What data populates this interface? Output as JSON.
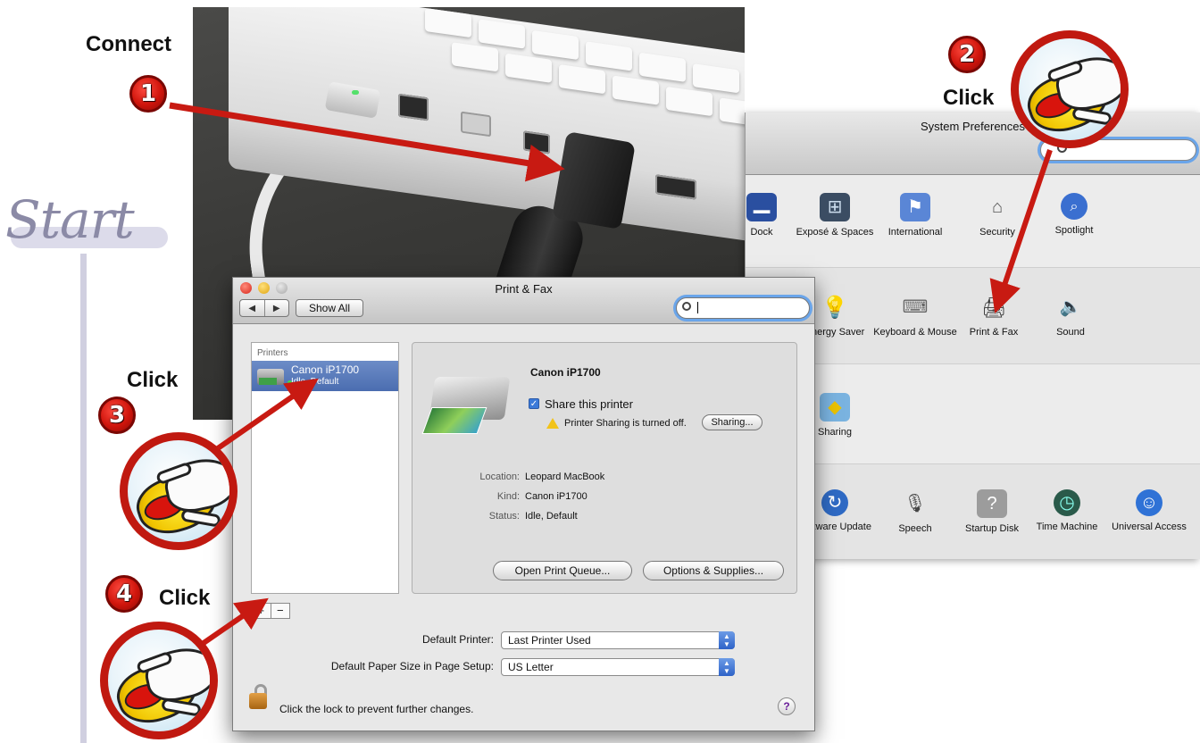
{
  "steps": {
    "start": "Start",
    "step1": {
      "number": "1",
      "label": "Connect"
    },
    "step2": {
      "number": "2",
      "label": "Click"
    },
    "step3": {
      "number": "3",
      "label": "Click"
    },
    "step4": {
      "number": "4",
      "label": "Click"
    }
  },
  "system_preferences": {
    "title": "System Preferences",
    "search_placeholder": "",
    "rows": [
      [
        {
          "label": "Dock",
          "icon": "dock-icon"
        },
        {
          "label": "Exposé & Spaces",
          "icon": "expose-icon"
        },
        {
          "label": "International",
          "icon": "international-flag-icon"
        },
        {
          "label": "Security",
          "icon": "security-house-icon"
        },
        {
          "label": "Spotlight",
          "icon": "spotlight-icon"
        }
      ],
      [
        {
          "label": "Energy Saver",
          "icon": "lightbulb-icon"
        },
        {
          "label": "Keyboard & Mouse",
          "icon": "keyboard-mouse-icon"
        },
        {
          "label": "Print & Fax",
          "icon": "printer-icon"
        },
        {
          "label": "Sound",
          "icon": "speaker-icon"
        }
      ],
      [
        {
          "label": "Sharing",
          "icon": "sharing-folder-icon"
        }
      ],
      [
        {
          "label": "Software Update",
          "icon": "software-update-icon"
        },
        {
          "label": "Speech",
          "icon": "microphone-icon"
        },
        {
          "label": "Startup Disk",
          "icon": "hard-disk-icon"
        },
        {
          "label": "Time Machine",
          "icon": "time-machine-icon"
        },
        {
          "label": "Universal Access",
          "icon": "universal-access-icon"
        }
      ]
    ]
  },
  "print_fax": {
    "title": "Print & Fax",
    "show_all": "Show All",
    "nav_back": "◀",
    "nav_forward": "▶",
    "search_value": "",
    "printers_header": "Printers",
    "printers": [
      {
        "name": "Canon iP1700",
        "status": "Idle, Default"
      }
    ],
    "add_button": "+",
    "remove_button": "−",
    "detail": {
      "name": "Canon iP1700",
      "share_label": "Share this printer",
      "share_checked": true,
      "warning": "Printer Sharing is turned off.",
      "sharing_button": "Sharing...",
      "location_label": "Location:",
      "location_value": "Leopard MacBook",
      "kind_label": "Kind:",
      "kind_value": "Canon iP1700",
      "status_label": "Status:",
      "status_value": "Idle, Default",
      "open_queue_button": "Open Print Queue...",
      "options_button": "Options & Supplies..."
    },
    "default_printer_label": "Default Printer:",
    "default_printer_value": "Last Printer Used",
    "default_paper_label": "Default Paper Size in Page Setup:",
    "default_paper_value": "US Letter",
    "lock_text": "Click the lock to prevent further changes.",
    "help_button": "?"
  },
  "colors": {
    "arrow_red": "#c81a12",
    "selection_blue": "#5577b8",
    "focus_ring": "#6aa5ea"
  }
}
